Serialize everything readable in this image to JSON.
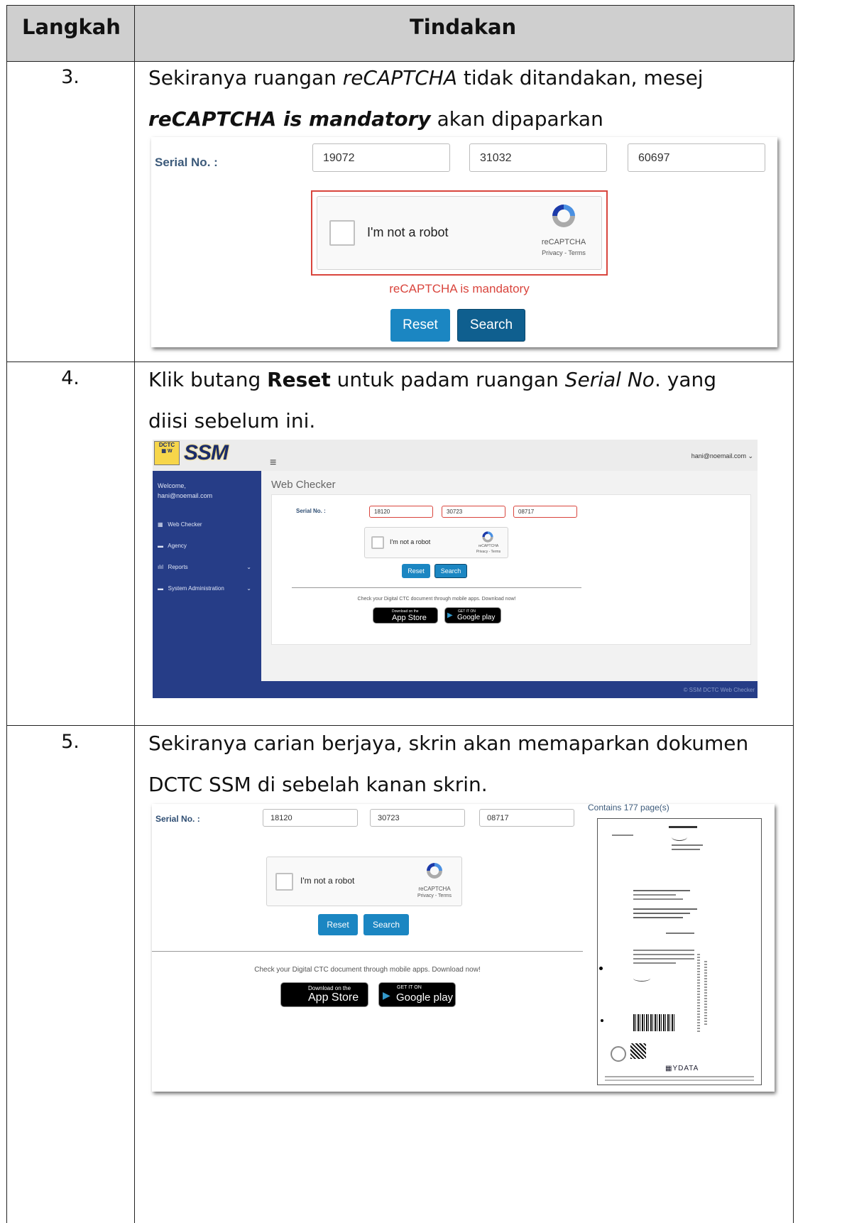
{
  "header": {
    "col1": "Langkah",
    "col2": "Tindakan"
  },
  "rows": [
    {
      "number": "3.",
      "line1_a": "Sekiranya ruangan ",
      "line1_b": "reCAPTCHA",
      "line1_c": " tidak ditandakan, mesej",
      "line2_a": "reCAPTCHA is mandatory",
      "line2_b": " akan dipaparkan",
      "screen": {
        "serial_label": "Serial No. :",
        "serial": [
          "19072",
          "31032",
          "60697"
        ],
        "captcha_label": "I'm not a robot",
        "captcha_brand": "reCAPTCHA",
        "captcha_links": "Privacy - Terms",
        "error": "reCAPTCHA is mandatory",
        "reset": "Reset",
        "search": "Search"
      }
    },
    {
      "number": "4.",
      "line1_a": "Klik butang ",
      "line1_b": "Reset",
      "line1_c": " untuk padam ruangan ",
      "line1_d": "Serial No",
      "line1_e": ". yang",
      "line2": "diisi sebelum ini.",
      "screen": {
        "logo_badge": "DCTC",
        "logo_text": "SSM",
        "user_menu": "hani@noemail.com",
        "welcome": "Welcome,",
        "email": "hani@noemail.com",
        "menu": [
          "Web Checker",
          "Agency",
          "Reports",
          "System Administration"
        ],
        "page_title": "Web Checker",
        "serial_label": "Serial No. :",
        "serial": [
          "18120",
          "30723",
          "08717"
        ],
        "captcha_label": "I'm not a robot",
        "captcha_brand": "reCAPTCHA",
        "captcha_links": "Privacy - Terms",
        "reset": "Reset",
        "search": "Search",
        "promo": "Check your Digital CTC document through mobile apps. Download now!",
        "appstore_small": "Download on the",
        "appstore_big": "App Store",
        "gplay_small": "GET IT ON",
        "gplay_big": "Google play",
        "footer": "© SSM DCTC Web Checker"
      }
    },
    {
      "number": "5.",
      "line1": "Sekiranya carian berjaya, skrin akan memaparkan dokumen",
      "line2": "DCTC SSM di sebelah kanan skrin.",
      "screen": {
        "serial_label": "Serial No. :",
        "serial": [
          "18120",
          "30723",
          "08717"
        ],
        "captcha_label": "I'm not a robot",
        "captcha_brand": "reCAPTCHA",
        "captcha_links": "Privacy - Terms",
        "reset": "Reset",
        "search": "Search",
        "promo": "Check your Digital CTC document through mobile apps. Download now!",
        "appstore_small": "Download on the",
        "appstore_big": "App Store",
        "gplay_small": "GET IT ON",
        "gplay_big": "Google play",
        "pages": "Contains 177 page(s)",
        "doc_logo": "YDATA"
      }
    }
  ],
  "colors": {
    "header_bg": "#cfcfcf",
    "reset": "#1b86c2",
    "search": "#0f5f8f",
    "error": "#d9453d",
    "sidebar": "#263d87"
  }
}
